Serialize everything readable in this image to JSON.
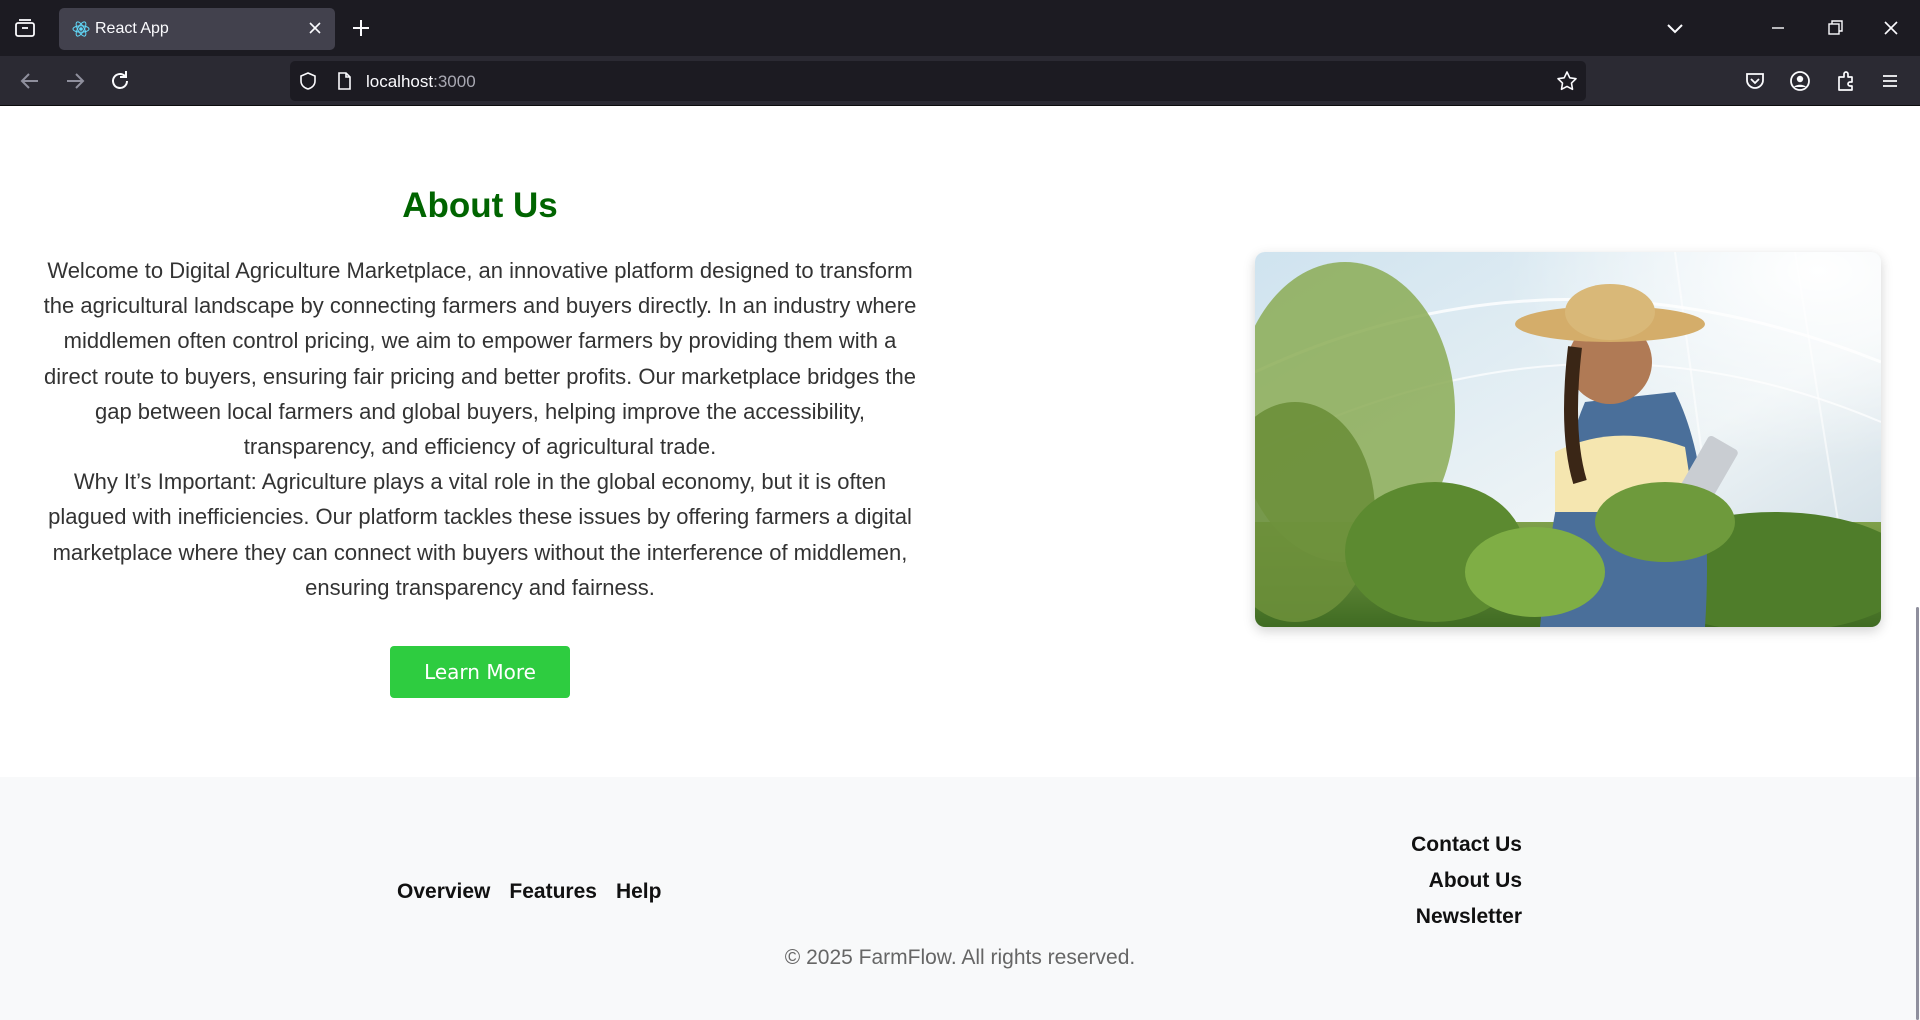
{
  "browser": {
    "tab_title": "React App",
    "url_host": "localhost",
    "url_port": ":3000",
    "icons": [
      "tab-list-icon",
      "react-favicon",
      "close-tab-icon",
      "new-tab-icon",
      "list-all-tabs-icon",
      "minimize-icon",
      "restore-icon",
      "close-window-icon",
      "back-icon",
      "forward-icon",
      "reload-icon",
      "shield-icon",
      "page-icon",
      "bookmark-star-icon",
      "pocket-icon",
      "account-icon",
      "extensions-icon",
      "menu-icon"
    ]
  },
  "about": {
    "heading": "About Us",
    "paragraph1": "Welcome to Digital Agriculture Marketplace, an innovative platform designed to transform the agricultural landscape by connecting farmers and buyers directly. In an industry where middlemen often control pricing, we aim to empower farmers by providing them with a direct route to buyers, ensuring fair pricing and better profits. Our marketplace bridges the gap between local farmers and global buyers, helping improve the accessibility, transparency, and efficiency of agricultural trade.",
    "paragraph2": "Why It’s Important: Agriculture plays a vital role in the global economy, but it is often plagued with inefficiencies. Our platform tackles these issues by offering farmers a digital marketplace where they can connect with buyers without the interference of middlemen, ensuring transparency and fairness.",
    "button_label": "Learn More",
    "accent_color": "#006400",
    "button_color": "#2ecc40"
  },
  "footer": {
    "links_left": [
      "Overview",
      "Features",
      "Help"
    ],
    "links_right": [
      "Contact Us",
      "About Us",
      "Newsletter"
    ],
    "copyright": "© 2025 FarmFlow. All rights reserved."
  }
}
